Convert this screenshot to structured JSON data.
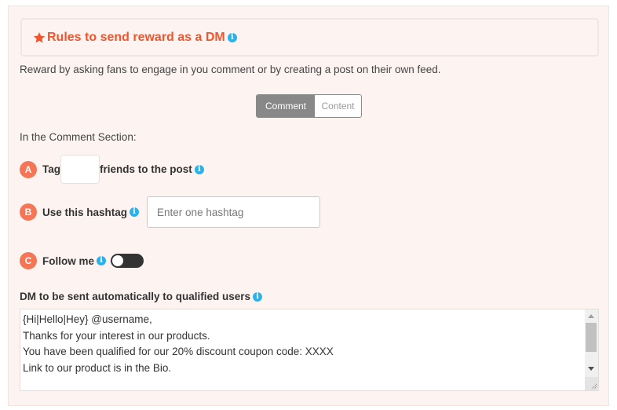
{
  "header": {
    "title": "Rules to send reward as a DM",
    "icon": "star-icon",
    "info_icon": "info-icon"
  },
  "description": "Reward by asking fans to engage in you comment or by creating a post on their own feed.",
  "segmented": {
    "options": [
      "Comment",
      "Content"
    ],
    "selected": "Comment"
  },
  "section_label": "In the Comment Section:",
  "rules": [
    {
      "badge": "A",
      "prefix": "Tag",
      "suffix": "friends to the post",
      "input_value": ""
    },
    {
      "badge": "B",
      "label": "Use this hashtag",
      "input_value": "",
      "placeholder": "Enter one hashtag"
    },
    {
      "badge": "C",
      "label": "Follow me",
      "toggle_on": false
    }
  ],
  "dm": {
    "label": "DM to be sent automatically to qualified users",
    "text": "{Hi|Hello|Hey} @username,\nThanks for your interest in our products.\nYou have been qualified for our 20% discount coupon code: XXXX\nLink to our product is in the Bio."
  },
  "colors": {
    "accent": "#f0562e",
    "badge": "#f47656",
    "info": "#2bb3e9",
    "panel_bg": "#fdf4f2"
  }
}
